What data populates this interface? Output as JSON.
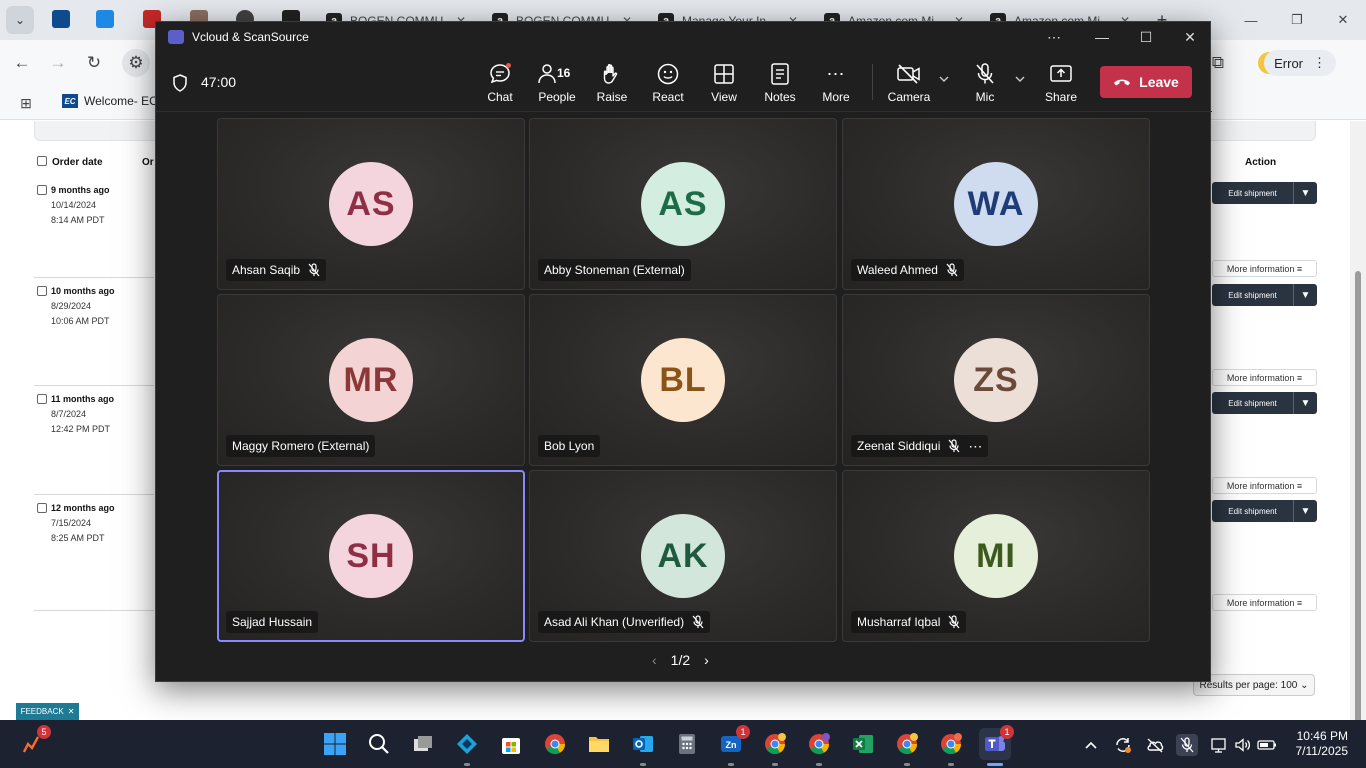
{
  "browser": {
    "tabs": [
      {
        "label": "",
        "icon": "ec-icon"
      },
      {
        "label": "",
        "icon": "g-icon"
      },
      {
        "label": "",
        "icon": "ext-icon"
      },
      {
        "label": "BOGEN COMMU...",
        "icon": "amazon-icon"
      },
      {
        "label": "BOGEN COMMU...",
        "icon": "amazon-icon"
      },
      {
        "label": "Manage Your In...",
        "icon": "amazon-icon"
      },
      {
        "label": "Amazon.com Mi...",
        "icon": "amazon-icon"
      },
      {
        "label": "Amazon.com Mi...",
        "icon": "amazon-icon"
      }
    ],
    "error_label": "Error",
    "bookmark": "Welcome- EC"
  },
  "page": {
    "columns": {
      "order_date": "Order date",
      "order": "Or",
      "action": "Action"
    },
    "orders": [
      {
        "ago": "9 months ago",
        "date": "10/14/2024",
        "time": "8:14 AM PDT"
      },
      {
        "ago": "10 months ago",
        "date": "8/29/2024",
        "time": "10:06 AM PDT"
      },
      {
        "ago": "11 months ago",
        "date": "8/7/2024",
        "time": "12:42 PM PDT"
      },
      {
        "ago": "12 months ago",
        "date": "7/15/2024",
        "time": "8:25 AM PDT"
      }
    ],
    "edit_shipment": "Edit shipment",
    "more_information": "More information ≡",
    "results_per_page": "Results per page: 100 ⌄",
    "feedback": "FEEDBACK"
  },
  "meeting": {
    "window_title": "Vcloud & ScanSource",
    "timer": "47:00",
    "people_count": "16",
    "toolbar": {
      "chat": "Chat",
      "people": "People",
      "raise": "Raise",
      "react": "React",
      "view": "View",
      "notes": "Notes",
      "more": "More",
      "camera": "Camera",
      "mic": "Mic",
      "share": "Share",
      "leave": "Leave"
    },
    "participants": [
      {
        "initials": "AS",
        "name": "Ahsan Saqib",
        "muted": true,
        "bg": "#f4d4dd",
        "fg": "#8f2f46"
      },
      {
        "initials": "AS",
        "name": "Abby Stoneman (External)",
        "muted": false,
        "bg": "#d3ede0",
        "fg": "#1e6b47"
      },
      {
        "initials": "WA",
        "name": "Waleed Ahmed",
        "muted": true,
        "bg": "#cfdbef",
        "fg": "#1d3c78"
      },
      {
        "initials": "MR",
        "name": "Maggy Romero (External)",
        "muted": false,
        "bg": "#f3d3d3",
        "fg": "#8c3838"
      },
      {
        "initials": "BL",
        "name": "Bob Lyon",
        "muted": false,
        "bg": "#fde6cf",
        "fg": "#8a5418"
      },
      {
        "initials": "ZS",
        "name": "Zeenat Siddiqui",
        "muted": true,
        "bg": "#ebdfd8",
        "fg": "#6b4a3a"
      },
      {
        "initials": "SH",
        "name": "Sajjad Hussain",
        "muted": false,
        "bg": "#f4d4dd",
        "fg": "#8f2f46"
      },
      {
        "initials": "AK",
        "name": "Asad Ali Khan (Unverified)",
        "muted": true,
        "bg": "#d3e6dc",
        "fg": "#1e5a3e"
      },
      {
        "initials": "MI",
        "name": "Musharraf Iqbal",
        "muted": true,
        "bg": "#e6efd9",
        "fg": "#3d5a1e"
      }
    ],
    "pager": "1/2"
  },
  "taskbar": {
    "badge_left": "5",
    "badge_zoom": "1",
    "badge_teams": "1",
    "clock_time": "10:46 PM",
    "clock_date": "7/11/2025"
  },
  "colors": {
    "leave": "#c4314b",
    "teams_accent": "#5b5fc7",
    "active_tile": "#8b87ff"
  }
}
